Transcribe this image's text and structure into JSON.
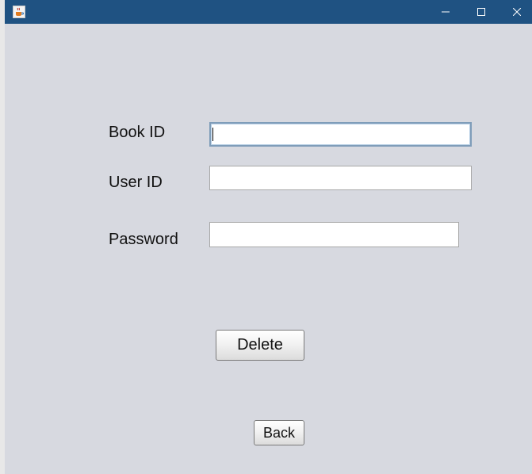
{
  "form": {
    "book_id_label": "Book ID",
    "user_id_label": "User ID",
    "password_label": "Password",
    "book_id_value": "",
    "user_id_value": "",
    "password_value": ""
  },
  "buttons": {
    "delete_label": "Delete",
    "back_label": "Back"
  },
  "colors": {
    "titlebar": "#1f5282",
    "window_bg": "#d7d9e0",
    "focus_border": "#7f9db9"
  },
  "icons": {
    "app": "java-coffee-cup-icon",
    "minimize": "minimize-icon",
    "maximize": "maximize-icon",
    "close": "close-icon"
  }
}
